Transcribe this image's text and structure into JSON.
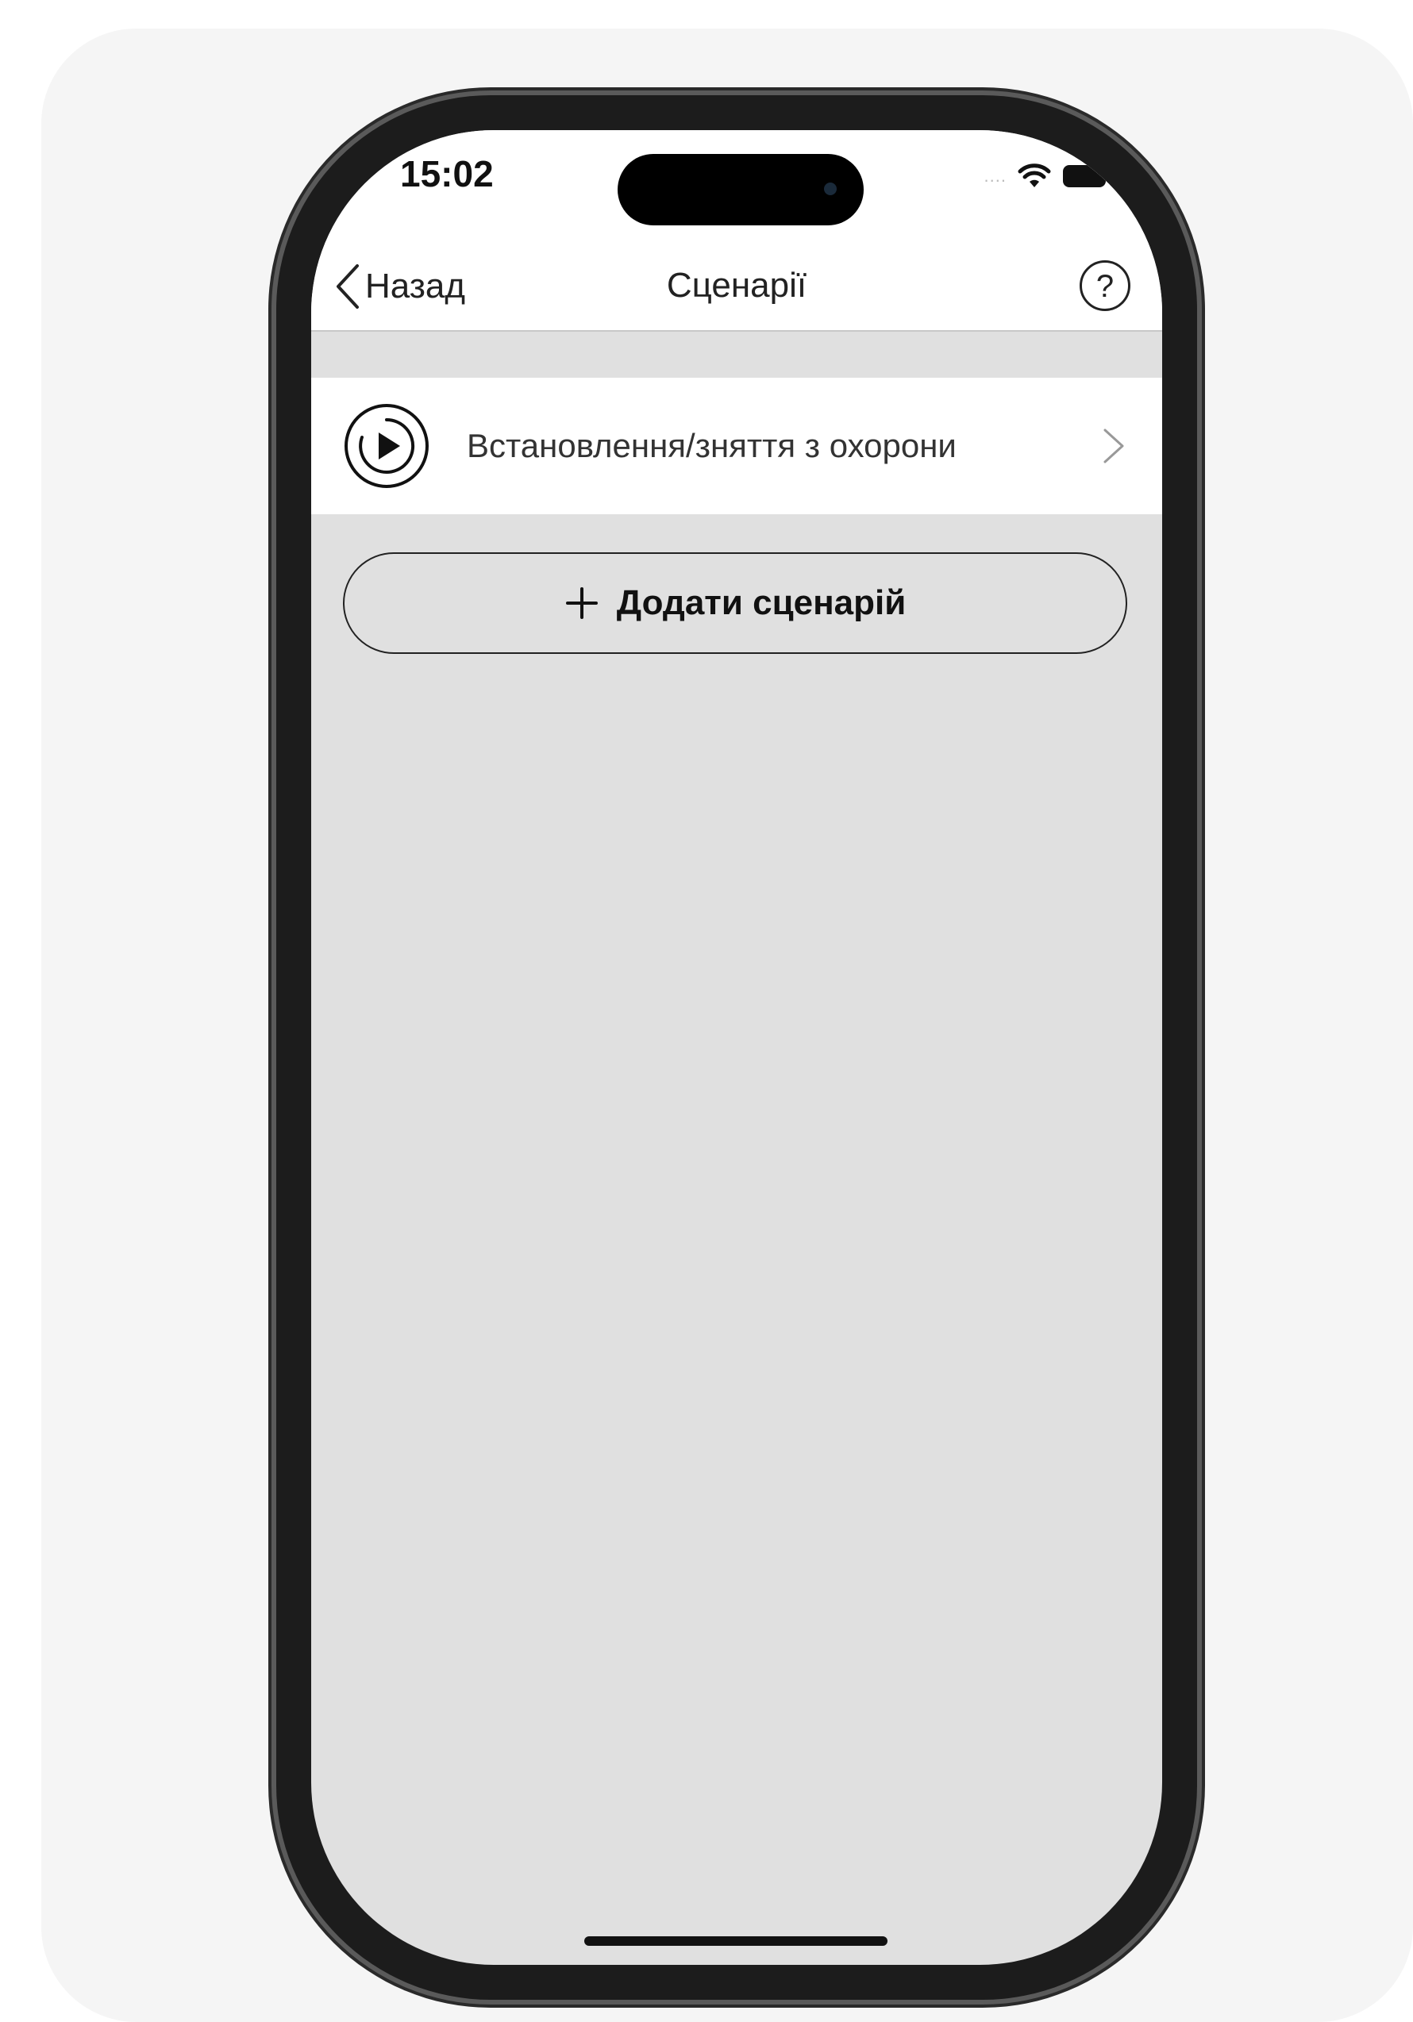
{
  "status_bar": {
    "time": "15:02",
    "signal_dots": "....",
    "icons": [
      "wifi-icon",
      "battery-icon"
    ]
  },
  "nav": {
    "back_label": "Назад",
    "title": "Сценарії",
    "help_symbol": "?"
  },
  "scenarios": [
    {
      "label": "Встановлення/зняття з охорони",
      "icon": "play-circle-icon"
    }
  ],
  "add_button": {
    "label": "Додати сценарій",
    "icon": "plus-icon"
  },
  "colors": {
    "background": "#e0e0e0",
    "surface": "#ffffff",
    "text": "#222222",
    "page": "#f5f5f5"
  }
}
